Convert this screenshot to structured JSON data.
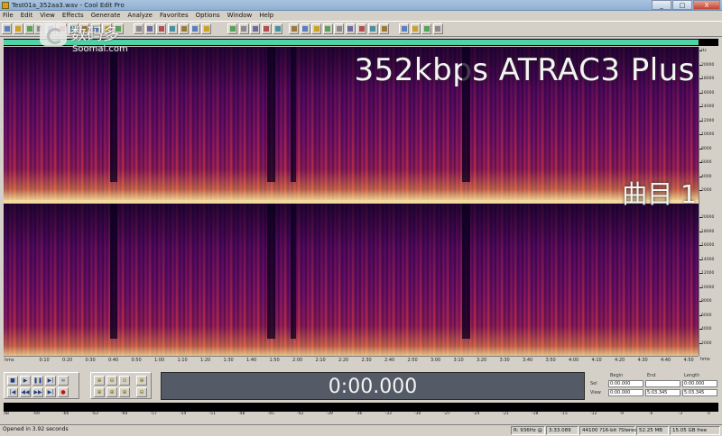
{
  "window": {
    "title": "Test01a_352aa3.wav - Cool Edit Pro",
    "controls": [
      "_",
      "□",
      "X"
    ]
  },
  "menu": [
    "File",
    "Edit",
    "View",
    "Effects",
    "Generate",
    "Analyze",
    "Favorites",
    "Options",
    "Window",
    "Help"
  ],
  "watermark": {
    "brand": "数码多",
    "site": "Soomal.com"
  },
  "overlay": {
    "title": "352kbps ATRAC3 Plus",
    "track": "曲目 1"
  },
  "freq_ruler": {
    "top": [
      "Hz",
      "20000",
      "18000",
      "16000",
      "14000",
      "12000",
      "10000",
      "8000",
      "6000",
      "4000",
      "2000"
    ],
    "bottom": [
      "20000",
      "18000",
      "16000",
      "14000",
      "12000",
      "10000",
      "8000",
      "6000",
      "4000",
      "2000"
    ]
  },
  "time_ruler": {
    "labels": [
      "hms",
      "0:10",
      "0:20",
      "0:30",
      "0:40",
      "0:50",
      "1:00",
      "1:10",
      "1:20",
      "1:30",
      "1:40",
      "1:50",
      "2:00",
      "2:10",
      "2:20",
      "2:30",
      "2:40",
      "2:50",
      "3:00",
      "3:10",
      "3:20",
      "3:30",
      "3:40",
      "3:50",
      "4:00",
      "4:10",
      "4:20",
      "4:30",
      "4:40",
      "4:50"
    ],
    "end": "hms"
  },
  "overview": {
    "fill_fraction": 1.0,
    "color": "#4fd3a8"
  },
  "time_display": "0:00.000",
  "selection": {
    "headers": {
      "begin": "Begin",
      "end": "End",
      "length": "Length"
    },
    "sel": {
      "label": "Sel",
      "begin": "0:00.000",
      "end": "",
      "length": "0:00.000"
    },
    "view": {
      "label": "View",
      "begin": "0:00.000",
      "end": "5:03.345",
      "length": "5:03.345"
    }
  },
  "meter_scale": [
    "dB",
    "-69",
    "-66",
    "-63",
    "-60",
    "-57",
    "-54",
    "-51",
    "-48",
    "-45",
    "-42",
    "-39",
    "-36",
    "-33",
    "-30",
    "-27",
    "-24",
    "-21",
    "-18",
    "-15",
    "-12",
    "-9",
    "-6",
    "-3",
    "0"
  ],
  "status": {
    "left": "Opened in 3.92 seconds",
    "r": "R: 936Hz @",
    "pos": "3:33.089",
    "format": "44100 ?16-bit ?Stereo",
    "size": "52.25 MB",
    "free": "15.05 GB free"
  }
}
